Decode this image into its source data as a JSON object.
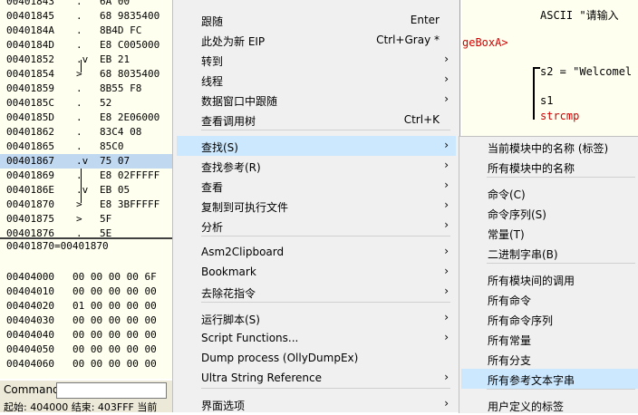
{
  "disasm": {
    "rows": [
      {
        "addr": "00401843",
        "mark": ".",
        "hex": "6A 00"
      },
      {
        "addr": "00401845",
        "mark": ".",
        "hex": "68 9835400"
      },
      {
        "addr": "0040184A",
        "mark": ".",
        "hex": "8B4D FC"
      },
      {
        "addr": "0040184D",
        "mark": ".",
        "hex": "E8 C005000"
      },
      {
        "addr": "00401852",
        "mark": ".v",
        "hex": "EB 21"
      },
      {
        "addr": "00401854",
        "mark": ">",
        "hex": "68 8035400"
      },
      {
        "addr": "00401859",
        "mark": ".",
        "hex": "8B55 F8"
      },
      {
        "addr": "0040185C",
        "mark": ".",
        "hex": "52"
      },
      {
        "addr": "0040185D",
        "mark": ".",
        "hex": "E8 2E06000"
      },
      {
        "addr": "00401862",
        "mark": ".",
        "hex": "83C4 08"
      },
      {
        "addr": "00401865",
        "mark": ".",
        "hex": "85C0"
      },
      {
        "addr": "00401867",
        "mark": ".v",
        "hex": "75 07"
      },
      {
        "addr": "00401869",
        "mark": ".",
        "hex": "E8 02FFFFF"
      },
      {
        "addr": "0040186E",
        "mark": ".v",
        "hex": "EB 05"
      },
      {
        "addr": "00401870",
        "mark": ">",
        "hex": "E8 3BFFFFF"
      },
      {
        "addr": "00401875",
        "mark": ">",
        "hex": "5F"
      },
      {
        "addr": "00401876",
        "mark": ".",
        "hex": "5E"
      }
    ],
    "info": "00401870=00401870"
  },
  "dump": {
    "rows": [
      {
        "addr": "00404000",
        "hex": "00 00 00 00 6F"
      },
      {
        "addr": "00404010",
        "hex": "00 00 00 00 00"
      },
      {
        "addr": "00404020",
        "hex": "01 00 00 00 00"
      },
      {
        "addr": "00404030",
        "hex": "00 00 00 00 00"
      },
      {
        "addr": "00404040",
        "hex": "00 00 00 00 00"
      },
      {
        "addr": "00404050",
        "hex": "00 00 00 00 00"
      },
      {
        "addr": "00404060",
        "hex": "00 00 00 00 00"
      }
    ]
  },
  "right": {
    "ascii": "ASCII \"请输入",
    "msgbox": "geBoxA>",
    "s2": "s2 = \"Welcomel",
    "s1": "s1",
    "strcmp": "strcmp"
  },
  "command": {
    "label": "Command"
  },
  "status": {
    "text": "起始: 404000  结束: 403FFF  当前"
  },
  "menu": [
    {
      "label": "跟随",
      "shortcut": "Enter",
      "arrow": ""
    },
    {
      "label": "此处为新 EIP",
      "shortcut": "Ctrl+Gray *",
      "arrow": ""
    },
    {
      "label": "转到",
      "shortcut": "",
      "arrow": "›"
    },
    {
      "label": "线程",
      "shortcut": "",
      "arrow": "›"
    },
    {
      "label": "数据窗口中跟随",
      "shortcut": "",
      "arrow": "›"
    },
    {
      "label": "查看调用树",
      "shortcut": "Ctrl+K",
      "arrow": ""
    },
    {
      "label": "查找(S)",
      "shortcut": "",
      "arrow": "›"
    },
    {
      "label": "查找参考(R)",
      "shortcut": "",
      "arrow": "›"
    },
    {
      "label": "查看",
      "shortcut": "",
      "arrow": "›"
    },
    {
      "label": "复制到可执行文件",
      "shortcut": "",
      "arrow": "›"
    },
    {
      "label": "分析",
      "shortcut": "",
      "arrow": "›"
    },
    {
      "label": "Asm2Clipboard",
      "shortcut": "",
      "arrow": "›"
    },
    {
      "label": "Bookmark",
      "shortcut": "",
      "arrow": "›"
    },
    {
      "label": "去除花指令",
      "shortcut": "",
      "arrow": "›"
    },
    {
      "label": "运行脚本(S)",
      "shortcut": "",
      "arrow": "›"
    },
    {
      "label": "Script Functions...",
      "shortcut": "",
      "arrow": "›"
    },
    {
      "label": "Dump process (OllyDumpEx)",
      "shortcut": "",
      "arrow": ""
    },
    {
      "label": "Ultra String Reference",
      "shortcut": "",
      "arrow": "›"
    },
    {
      "label": "界面选项",
      "shortcut": "",
      "arrow": "›"
    }
  ],
  "submenu": [
    {
      "label": "当前模块中的名称 (标签)"
    },
    {
      "label": "所有模块中的名称"
    },
    {
      "label": "命令(C)"
    },
    {
      "label": "命令序列(S)"
    },
    {
      "label": "常量(T)"
    },
    {
      "label": "二进制字串(B)"
    },
    {
      "label": "所有模块间的调用"
    },
    {
      "label": "所有命令"
    },
    {
      "label": "所有命令序列"
    },
    {
      "label": "所有常量"
    },
    {
      "label": "所有分支"
    },
    {
      "label": "所有参考文本字串"
    },
    {
      "label": "用户定义的标签"
    }
  ],
  "colors": {
    "highlight": "#cce8ff",
    "selected_row": "#c0d8f0",
    "pane_bg": "#fffff0",
    "menu_bg": "#f0f0f0",
    "strcmp": "#d00000",
    "msgbox": "#d00000"
  }
}
